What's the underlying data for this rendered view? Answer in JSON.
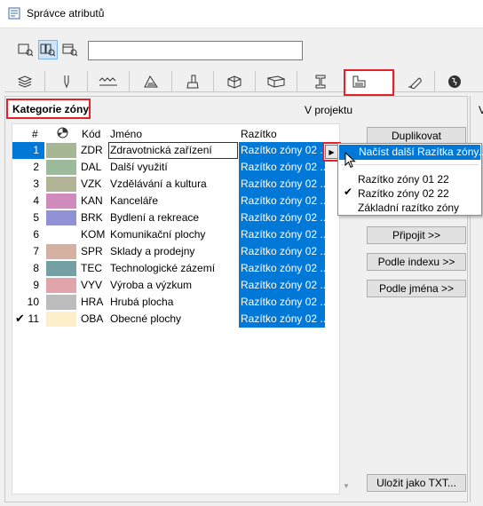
{
  "window": {
    "title": "Správce atributů"
  },
  "toolbar": {
    "search_value": ""
  },
  "tabs": [
    {
      "icon": "layers-icon"
    },
    {
      "icon": "pen-icon"
    },
    {
      "icon": "line-type-icon"
    },
    {
      "icon": "fill-icon"
    },
    {
      "icon": "surface-icon"
    },
    {
      "icon": "building-material-icon"
    },
    {
      "icon": "composite-icon"
    },
    {
      "icon": "profile-icon"
    },
    {
      "icon": "zone-category-icon"
    },
    {
      "icon": "mep-icon"
    },
    {
      "icon": "globe-icon"
    }
  ],
  "panel": {
    "category_label": "Kategorie zóny",
    "in_project_label": "V projektu",
    "right_clipped": "V"
  },
  "table": {
    "headers": {
      "num": "#",
      "color": "",
      "code": "Kód",
      "name": "Jméno",
      "stamp": "Razítko"
    },
    "rows": [
      {
        "num": "1",
        "code": "ZDR",
        "name": "Zdravotnická zařízení",
        "stamp": "Razítko zóny 02 ...",
        "color": "#a6b794",
        "selected": true
      },
      {
        "num": "2",
        "code": "DAL",
        "name": "Další využití",
        "stamp": "Razítko zóny 02 ...",
        "color": "#9cbb9c"
      },
      {
        "num": "3",
        "code": "VZK",
        "name": "Vzdělávání a kultura",
        "stamp": "Razítko zóny 02 ...",
        "color": "#b3b496"
      },
      {
        "num": "4",
        "code": "KAN",
        "name": "Kanceláře",
        "stamp": "Razítko zóny 02 ...",
        "color": "#cf8bbb"
      },
      {
        "num": "5",
        "code": "BRK",
        "name": "Bydlení a rekreace",
        "stamp": "Razítko zóny 02 ...",
        "color": "#9191d6"
      },
      {
        "num": "6",
        "code": "KOM",
        "name": "Komunikační plochy",
        "stamp": "Razítko zóny 02 ...",
        "color": "#ffffff"
      },
      {
        "num": "7",
        "code": "SPR",
        "name": "Sklady a prodejny",
        "stamp": "Razítko zóny 02 ...",
        "color": "#d5b1a4"
      },
      {
        "num": "8",
        "code": "TEC",
        "name": "Technologické zázemí",
        "stamp": "Razítko zóny 02 ...",
        "color": "#74a0a4"
      },
      {
        "num": "9",
        "code": "VYV",
        "name": "Výroba a výzkum",
        "stamp": "Razítko zóny 02 ...",
        "color": "#e0a4aa"
      },
      {
        "num": "10",
        "code": "HRA",
        "name": "Hrubá plocha",
        "stamp": "Razítko zóny 02 ...",
        "color": "#bcbcbc"
      },
      {
        "num": "11",
        "code": "OBA",
        "name": "Obecné plochy",
        "stamp": "Razítko zóny 02 ...",
        "color": "#fdefca",
        "checked": true
      }
    ]
  },
  "buttons": {
    "duplicate": "Duplikovat",
    "attach": "Připojit >>",
    "by_index": "Podle indexu >>",
    "by_name": "Podle jména >>",
    "save_txt": "Uložit jako TXT..."
  },
  "menu": {
    "load_more": "Načíst další Razítka zóny...",
    "items": [
      "Razítko zóny 01 22",
      "Razítko zóny 02 22",
      "Základní razítko zóny"
    ],
    "checked_index": 1
  }
}
